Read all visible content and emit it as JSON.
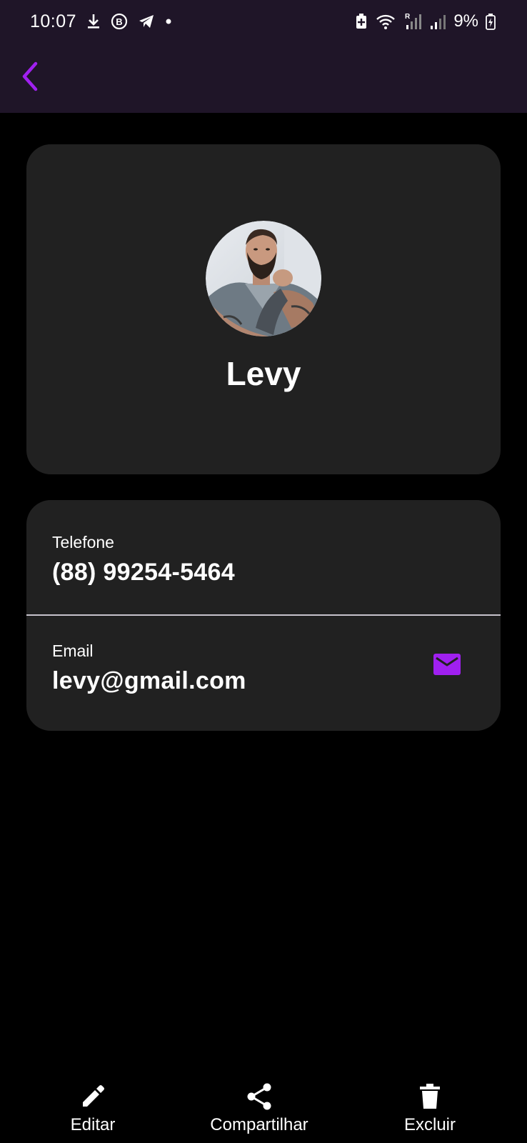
{
  "status_bar": {
    "time": "10:07",
    "battery_percent": "9%",
    "left_icons": [
      "download-icon",
      "business-b-icon",
      "telegram-icon",
      "dot-icon"
    ],
    "right_icons": [
      "battery-saver-icon",
      "wifi-icon",
      "signal-roaming-icon",
      "signal-icon",
      "battery-charging-icon"
    ]
  },
  "app_bar": {
    "back_icon": "chevron-left-icon"
  },
  "contact": {
    "name": "Levy",
    "phone_label": "Telefone",
    "phone_value": "(88) 99254-5464",
    "email_label": "Email",
    "email_value": "levy@gmail.com"
  },
  "actions": {
    "edit": "Editar",
    "share": "Compartilhar",
    "delete": "Excluir"
  },
  "colors": {
    "accent": "#a020f0",
    "header_bg": "#1f1528",
    "card_bg": "#212121",
    "background": "#000000"
  }
}
